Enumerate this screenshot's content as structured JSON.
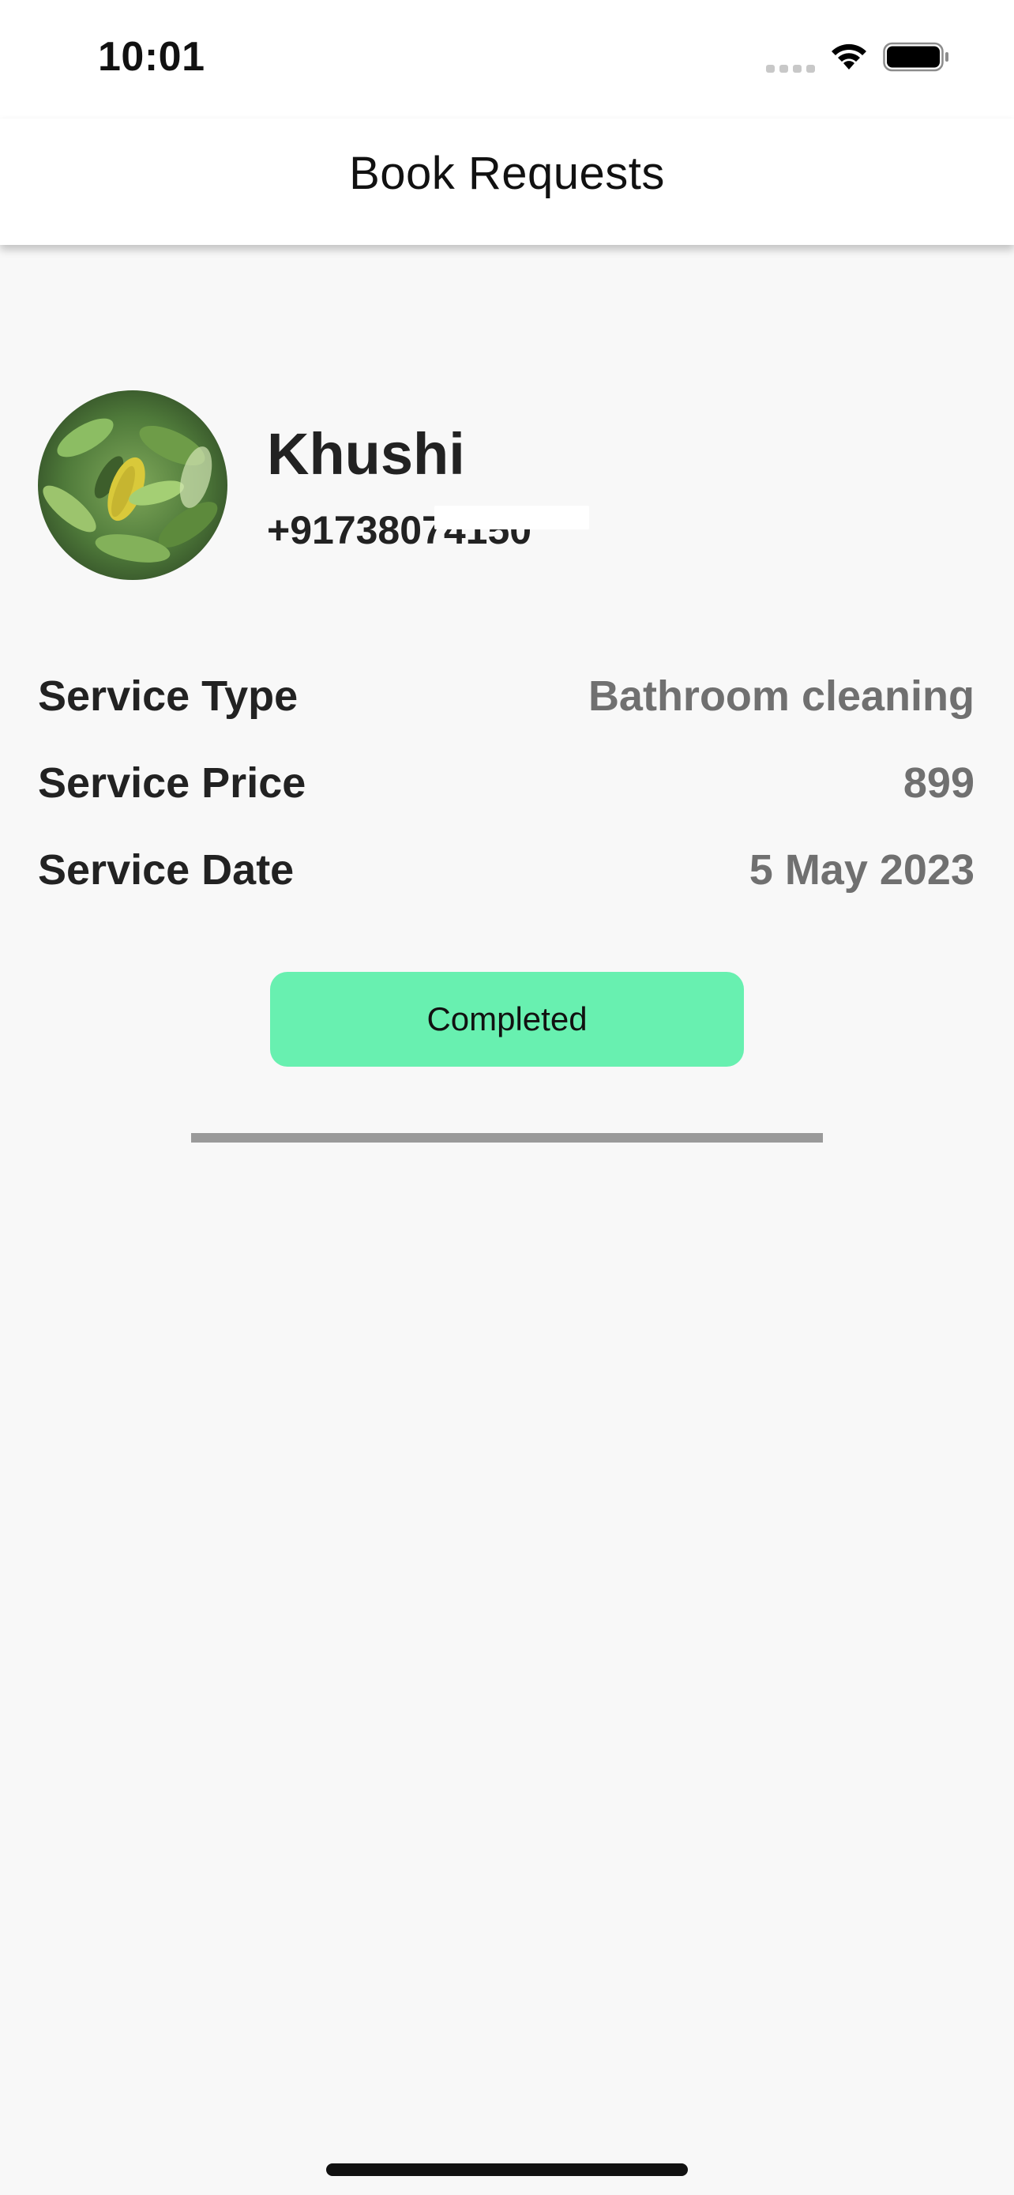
{
  "status_bar": {
    "time": "10:01"
  },
  "app_bar": {
    "title": "Book Requests"
  },
  "profile": {
    "name": "Khushi",
    "phone": "+91738074150",
    "avatar_description": "leaf-photo"
  },
  "details": [
    {
      "label": "Service Type",
      "value": "Bathroom cleaning"
    },
    {
      "label": "Service Price",
      "value": "899"
    },
    {
      "label": "Service Date",
      "value": "5 May 2023"
    }
  ],
  "status_button": {
    "label": "Completed",
    "color": "#68f0b0"
  },
  "colors": {
    "background": "#f8f8f8",
    "text_primary": "#222222",
    "text_secondary": "#707070",
    "divider": "#9a9a9a"
  }
}
